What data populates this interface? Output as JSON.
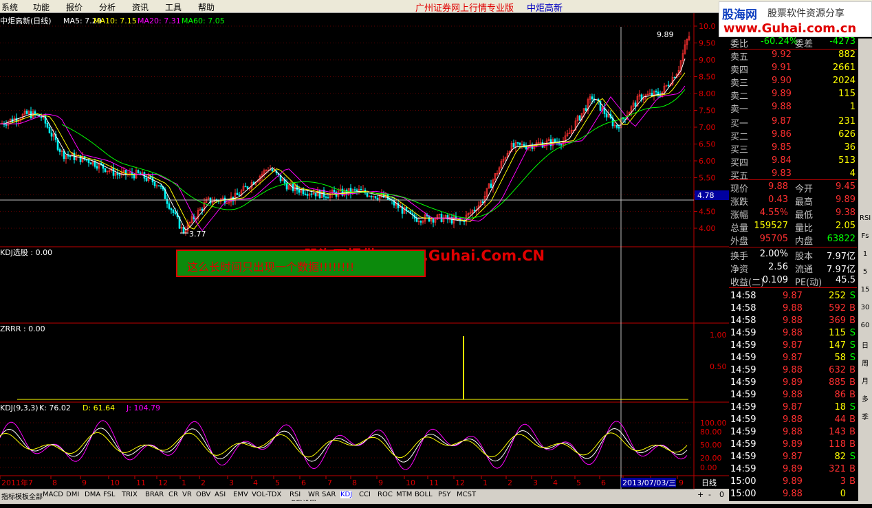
{
  "menubar": {
    "items": [
      "系统",
      "功能",
      "报价",
      "分析",
      "资讯",
      "工具",
      "帮助"
    ],
    "notice": "广州证券网上行情专业版",
    "stock_name": "中炬高新"
  },
  "logo": {
    "title": "股海网",
    "subtitle": "股票软件资源分享",
    "url": "www.Guhai.com.cn"
  },
  "price_panel": {
    "header": "中炬高新(日线)",
    "ma": [
      {
        "label": "MA5: 7.29",
        "color": "#ffffff"
      },
      {
        "label": "MA10: 7.15",
        "color": "#ffff00"
      },
      {
        "label": "MA20: 7.31",
        "color": "#ff00ff"
      },
      {
        "label": "MA60: 7.05",
        "color": "#00ff00"
      }
    ],
    "high_label": "9.89",
    "low_label": "3.77",
    "current_tag": "4.78",
    "y_ticks": [
      "10.0",
      "9.50",
      "9.00",
      "8.50",
      "8.00",
      "7.50",
      "7.00",
      "6.50",
      "6.00",
      "5.50",
      "5.00",
      "4.50",
      "4.00"
    ]
  },
  "panel2": {
    "header": "KDJ选股 : 0.00"
  },
  "panel3": {
    "header": "ZRRR : 0.00",
    "y_ticks": [
      "1.00",
      "0.50"
    ]
  },
  "panel4": {
    "header": "KDJ(9,3,3)",
    "k": "K: 76.02",
    "d": "D: 61.64",
    "j": "J: 104.79",
    "y_ticks": [
      "100.00",
      "80.00",
      "50.00",
      "20.00",
      "0.00"
    ]
  },
  "xaxis": {
    "labels": [
      "2011年7",
      "8",
      "9",
      "10",
      "11",
      "12",
      "1",
      "2",
      "3",
      "4",
      "5",
      "6",
      "7",
      "8",
      "9",
      "10",
      "11",
      "12",
      "1",
      "2",
      "3",
      "4",
      "5",
      "6",
      "7",
      "8",
      "9"
    ],
    "cursor_date": "2013/07/03/三",
    "period": "日线"
  },
  "overlay": {
    "watermark": "股海网提供 Www.Guhai.Com.CN",
    "message": "这么长时间只出现一个数据!!!!!!!!"
  },
  "orderbook": {
    "top_row": {
      "l1": "委比",
      "v1": "-60.24%",
      "l2": "委差",
      "v2": "-4273"
    },
    "sell": [
      {
        "label": "卖五",
        "price": "9.92",
        "vol": "882"
      },
      {
        "label": "卖四",
        "price": "9.91",
        "vol": "2661"
      },
      {
        "label": "卖三",
        "price": "9.90",
        "vol": "2024"
      },
      {
        "label": "卖二",
        "price": "9.89",
        "vol": "115"
      },
      {
        "label": "卖一",
        "price": "9.88",
        "vol": "1"
      }
    ],
    "buy": [
      {
        "label": "买一",
        "price": "9.87",
        "vol": "231"
      },
      {
        "label": "买二",
        "price": "9.86",
        "vol": "626"
      },
      {
        "label": "买三",
        "price": "9.85",
        "vol": "36"
      },
      {
        "label": "买四",
        "price": "9.84",
        "vol": "513"
      },
      {
        "label": "买五",
        "price": "9.83",
        "vol": "4"
      }
    ]
  },
  "quote": [
    {
      "l1": "现价",
      "v1": "9.88",
      "l2": "今开",
      "v2": "9.45"
    },
    {
      "l1": "涨跌",
      "v1": "0.43",
      "l2": "最高",
      "v2": "9.89"
    },
    {
      "l1": "涨幅",
      "v1": "4.55%",
      "l2": "最低",
      "v2": "9.38"
    },
    {
      "l1": "总量",
      "v1": "159527",
      "l2": "量比",
      "v2": "2.05"
    },
    {
      "l1": "外盘",
      "v1": "95705",
      "l2": "内盘",
      "v2": "63822"
    }
  ],
  "fundamentals": [
    {
      "l1": "换手",
      "v1": "2.00%",
      "l2": "股本",
      "v2": "7.97亿"
    },
    {
      "l1": "净资",
      "v1": "2.56",
      "l2": "流通",
      "v2": "7.97亿"
    },
    {
      "l1": "收益(二)",
      "v1": "0.109",
      "l2": "PE(动)",
      "v2": "45.5"
    }
  ],
  "ticks": [
    {
      "t": "14:58",
      "p": "9.87",
      "v": "252",
      "s": "S"
    },
    {
      "t": "14:58",
      "p": "9.88",
      "v": "592",
      "s": "B"
    },
    {
      "t": "14:58",
      "p": "9.88",
      "v": "369",
      "s": "B"
    },
    {
      "t": "14:59",
      "p": "9.88",
      "v": "115",
      "s": "S"
    },
    {
      "t": "14:59",
      "p": "9.87",
      "v": "147",
      "s": "S"
    },
    {
      "t": "14:59",
      "p": "9.87",
      "v": "58",
      "s": "S"
    },
    {
      "t": "14:59",
      "p": "9.88",
      "v": "632",
      "s": "B"
    },
    {
      "t": "14:59",
      "p": "9.89",
      "v": "885",
      "s": "B"
    },
    {
      "t": "14:59",
      "p": "9.88",
      "v": "86",
      "s": "B"
    },
    {
      "t": "14:59",
      "p": "9.87",
      "v": "18",
      "s": "S"
    },
    {
      "t": "14:59",
      "p": "9.88",
      "v": "44",
      "s": "B"
    },
    {
      "t": "14:59",
      "p": "9.88",
      "v": "143",
      "s": "B"
    },
    {
      "t": "14:59",
      "p": "9.89",
      "v": "118",
      "s": "B"
    },
    {
      "t": "14:59",
      "p": "9.87",
      "v": "82",
      "s": "S"
    },
    {
      "t": "14:59",
      "p": "9.89",
      "v": "321",
      "s": "B"
    },
    {
      "t": "15:00",
      "p": "9.89",
      "v": "3",
      "s": "B"
    },
    {
      "t": "15:00",
      "p": "9.88",
      "v": "0",
      "s": ""
    }
  ],
  "toolstrip": [
    "RSI",
    "Fs",
    "1",
    "5",
    "15",
    "30",
    "60",
    "日",
    "周",
    "月",
    "多",
    "季"
  ],
  "bottom_tabs": [
    "指标",
    "模板",
    "全部",
    "MACD",
    "DMI",
    "DMA",
    "FSL",
    "TRIX",
    "BRAR",
    "CR",
    "VR",
    "OBV",
    "ASI",
    "EMV",
    "VOL-TDX",
    "RSI",
    "WR",
    "SAR",
    "KDJ",
    "CCI",
    "ROC",
    "MTM",
    "BOLL",
    "PSY",
    "MCST"
  ],
  "bottom_extra": {
    "click_hint": "点我设置",
    "plus": "+",
    "minus": "-",
    "zero": "0"
  },
  "colors": {
    "up": "#ff3030",
    "down": "#00ffff",
    "ma5": "#ffffff",
    "ma10": "#ffff00",
    "ma20": "#ff00ff",
    "ma60": "#00ff00",
    "grid": "#800000",
    "axis": "#c00000"
  }
}
